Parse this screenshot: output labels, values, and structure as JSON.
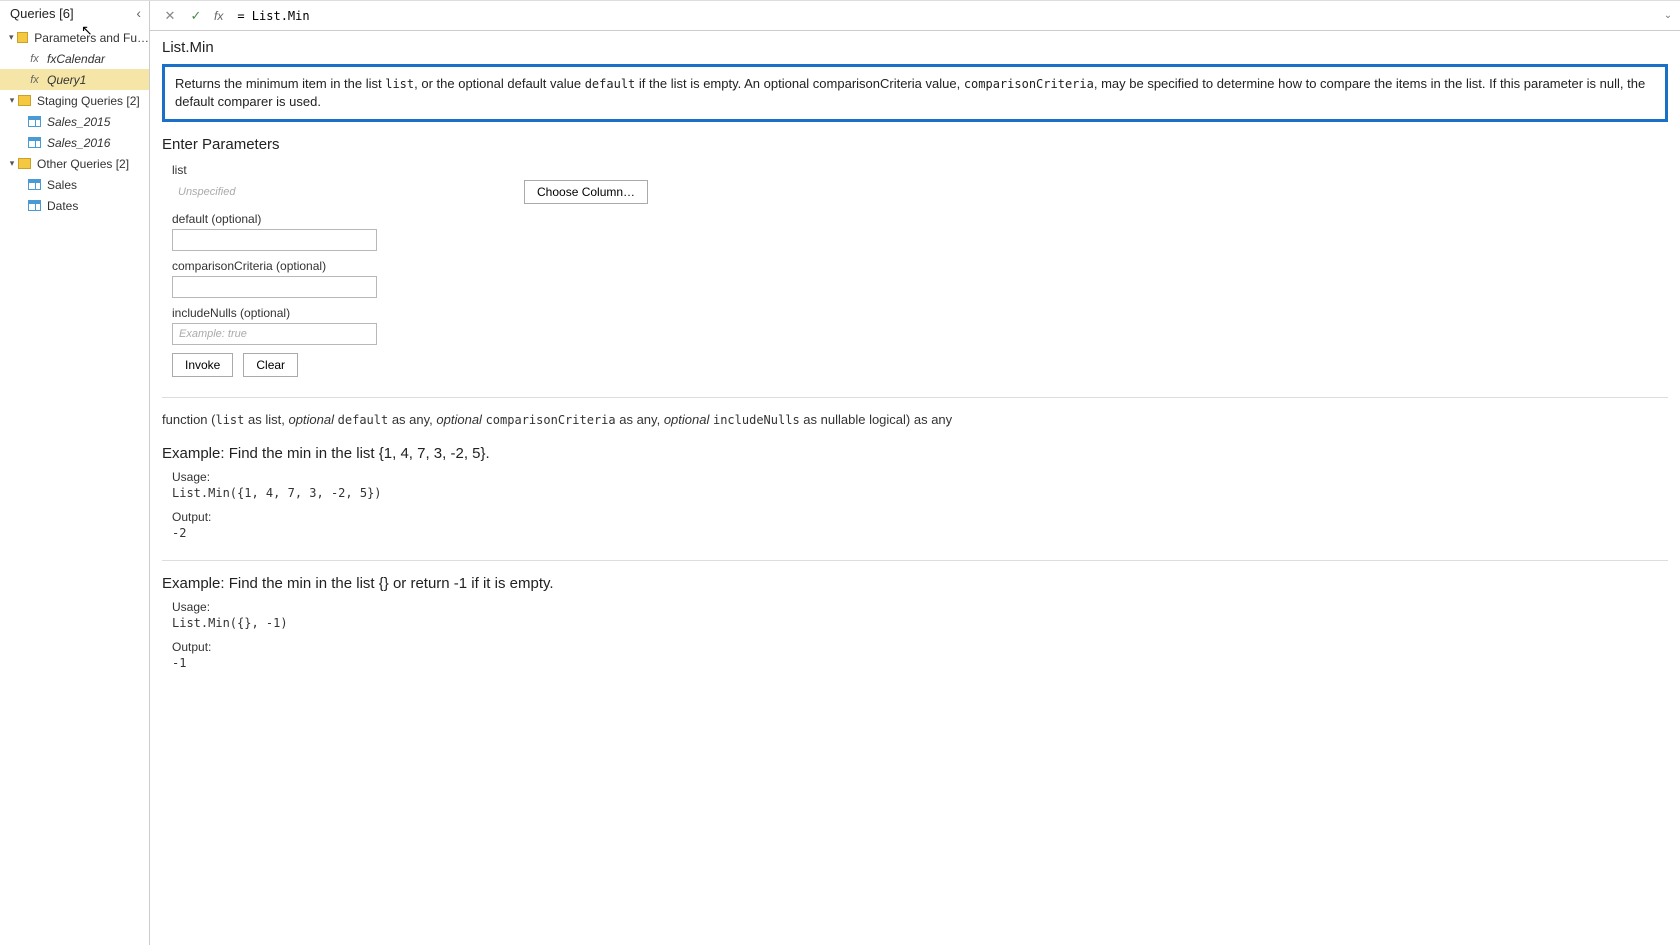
{
  "sidebar": {
    "title": "Queries [6]",
    "groups": [
      {
        "label": "Parameters and Fu…",
        "type": "folder",
        "children": [
          {
            "label": "fxCalendar",
            "icon": "fx",
            "italic": true
          },
          {
            "label": "Query1",
            "icon": "fx",
            "italic": true,
            "selected": true
          }
        ]
      },
      {
        "label": "Staging Queries [2]",
        "type": "folder",
        "children": [
          {
            "label": "Sales_2015",
            "icon": "table",
            "italic": true
          },
          {
            "label": "Sales_2016",
            "icon": "table",
            "italic": true
          }
        ]
      },
      {
        "label": "Other Queries [2]",
        "type": "folder",
        "children": [
          {
            "label": "Sales",
            "icon": "table"
          },
          {
            "label": "Dates",
            "icon": "table"
          }
        ]
      }
    ]
  },
  "formula_bar": {
    "value": "= List.Min"
  },
  "function": {
    "name": "List.Min",
    "description": {
      "pre": "Returns the minimum item in the list ",
      "c1": "list",
      "mid1": ", or the optional default value ",
      "c2": "default",
      "mid2": " if the list is empty. An optional comparisonCriteria value, ",
      "c3": "comparisonCriteria",
      "mid3": ", may be specified to determine how to compare the items in the list. If this parameter is null, the default comparer is used."
    },
    "params_title": "Enter Parameters",
    "params": {
      "list": {
        "label": "list",
        "placeholder": "Unspecified",
        "choose": "Choose Column…"
      },
      "default": {
        "label": "default (optional)"
      },
      "comparison": {
        "label": "comparisonCriteria (optional)"
      },
      "includeNulls": {
        "label": "includeNulls (optional)",
        "placeholder": "Example: true"
      }
    },
    "buttons": {
      "invoke": "Invoke",
      "clear": "Clear"
    },
    "signature": {
      "t0": "function (",
      "p1": "list",
      "t1": " as list, ",
      "o": "optional",
      "p2": "default",
      "t2": " as any, ",
      "p3": "comparisonCriteria",
      "t3": " as any, ",
      "p4": "includeNulls",
      "t4": " as nullable logical) as any"
    },
    "examples": [
      {
        "title": "Example: Find the min in the list {1, 4, 7, 3, -2, 5}.",
        "usage_label": "Usage:",
        "usage_code": "List.Min({1, 4, 7, 3, -2, 5})",
        "output_label": "Output:",
        "output_code": "-2"
      },
      {
        "title": "Example: Find the min in the list {} or return -1 if it is empty.",
        "usage_label": "Usage:",
        "usage_code": "List.Min({}, -1)",
        "output_label": "Output:",
        "output_code": "-1"
      }
    ]
  }
}
